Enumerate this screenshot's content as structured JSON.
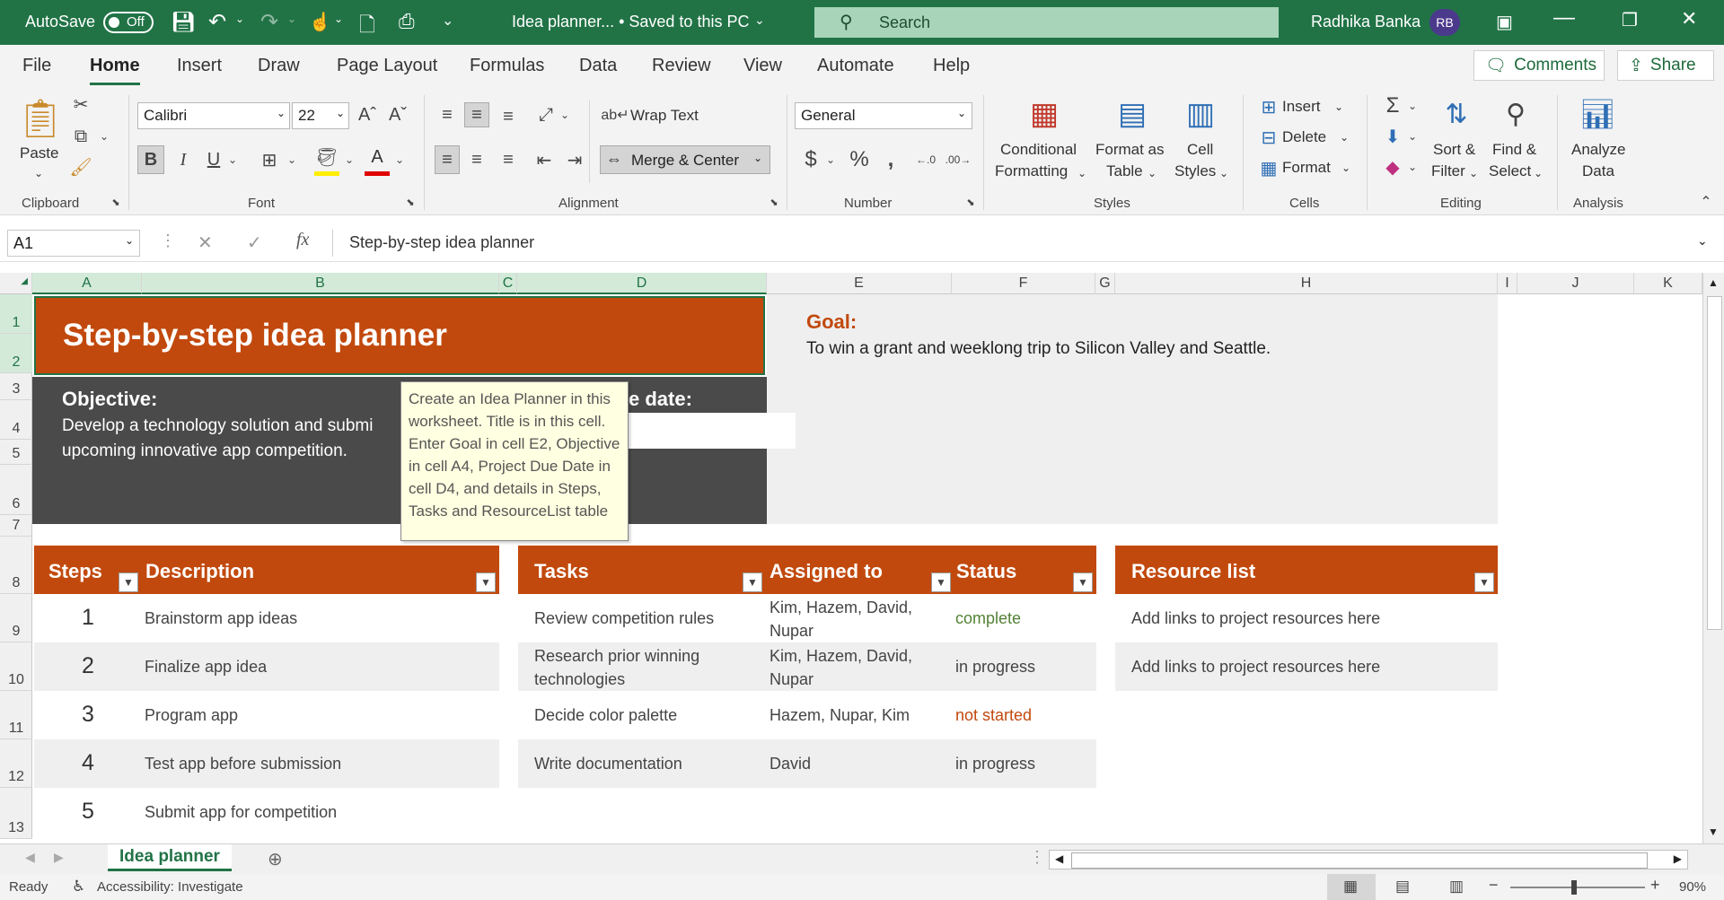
{
  "titlebar": {
    "autosave_label": "AutoSave",
    "autosave_state": "Off",
    "doc_title": "Idea planner... • Saved to this PC",
    "search_placeholder": "Search",
    "user_name": "Radhika Banka",
    "user_initials": "RB"
  },
  "menu": {
    "tabs": [
      "File",
      "Home",
      "Insert",
      "Draw",
      "Page Layout",
      "Formulas",
      "Data",
      "Review",
      "View",
      "Automate",
      "Help"
    ],
    "active": "Home",
    "comments": "Comments",
    "share": "Share"
  },
  "ribbon": {
    "clipboard": {
      "label": "Clipboard",
      "paste": "Paste"
    },
    "font": {
      "label": "Font",
      "name": "Calibri",
      "size": "22",
      "bold": "B",
      "italic": "I",
      "underline": "U"
    },
    "alignment": {
      "label": "Alignment",
      "wrap": "Wrap Text",
      "merge": "Merge & Center"
    },
    "number": {
      "label": "Number",
      "format": "General"
    },
    "styles": {
      "label": "Styles",
      "conditional": "Conditional",
      "formatting": "Formatting",
      "format_as": "Format as",
      "table": "Table",
      "cell": "Cell",
      "cell_styles": "Styles"
    },
    "cells": {
      "label": "Cells",
      "insert": "Insert",
      "delete": "Delete",
      "format": "Format"
    },
    "editing": {
      "label": "Editing",
      "sort1": "Sort &",
      "sort2": "Filter",
      "find1": "Find &",
      "find2": "Select"
    },
    "analysis": {
      "label": "Analysis",
      "analyze1": "Analyze",
      "analyze2": "Data"
    }
  },
  "formula_bar": {
    "name_box": "A1",
    "fx": "fx",
    "value": "Step-by-step idea planner"
  },
  "columns": [
    "A",
    "B",
    "C",
    "D",
    "E",
    "F",
    "G",
    "H",
    "I",
    "J",
    "K"
  ],
  "rows": [
    "1",
    "2",
    "3",
    "4",
    "5",
    "6",
    "7",
    "8",
    "9",
    "10",
    "11",
    "12",
    "13"
  ],
  "sheet": {
    "title": "Step-by-step idea planner",
    "goal_label": "Goal:",
    "goal_text": "To win a grant and weeklong trip to Silicon Valley and Seattle.",
    "objective_label": "Objective:",
    "objective_line1": "Develop a technology solution and submi",
    "objective_line2": "upcoming innovative app competition.",
    "due_label": "e date:",
    "tooltip": "Create an Idea Planner in this worksheet. Title is in this cell. Enter Goal in cell E2, Objective in cell A4, Project Due Date in cell D4, and details in Steps, Tasks and ResourceList table"
  },
  "steps_table": {
    "headers": [
      "Steps",
      "Description"
    ],
    "rows": [
      {
        "num": "1",
        "desc": "Brainstorm app ideas"
      },
      {
        "num": "2",
        "desc": "Finalize app idea"
      },
      {
        "num": "3",
        "desc": "Program app"
      },
      {
        "num": "4",
        "desc": "Test app before submission"
      },
      {
        "num": "5",
        "desc": "Submit app for competition"
      }
    ]
  },
  "tasks_table": {
    "headers": [
      "Tasks",
      "Assigned to",
      "Status"
    ],
    "rows": [
      {
        "task": "Review competition rules",
        "assigned1": "Kim, Hazem, David,",
        "assigned2": "Nupar",
        "status": "complete",
        "status_color": "#548235"
      },
      {
        "task": "Research prior winning",
        "task2": "technologies",
        "assigned1": "Kim, Hazem, David,",
        "assigned2": "Nupar",
        "status": "in progress",
        "status_color": "#444444"
      },
      {
        "task": "Decide color palette",
        "assigned1": "Hazem, Nupar, Kim",
        "status": "not started",
        "status_color": "#c2490d"
      },
      {
        "task": "Write documentation",
        "assigned1": "David",
        "status": "in progress",
        "status_color": "#444444"
      }
    ]
  },
  "resource_table": {
    "header": "Resource list",
    "rows": [
      "Add links to project resources here",
      "Add links to project resources here"
    ]
  },
  "tabs": {
    "active": "Idea planner"
  },
  "status": {
    "ready": "Ready",
    "accessibility": "Accessibility: Investigate",
    "zoom": "90%"
  },
  "colors": {
    "brand": "#217346",
    "accent": "#c2490d",
    "dark_block": "#4a4a4a"
  }
}
